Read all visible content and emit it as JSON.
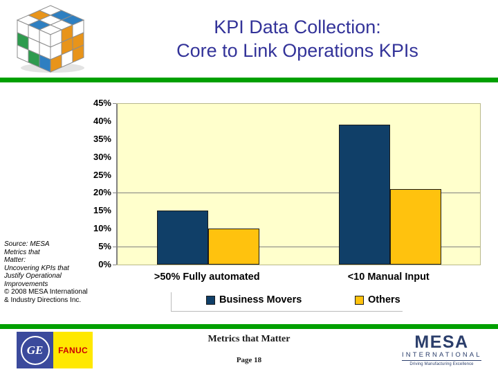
{
  "slide": {
    "title_lines": [
      "KPI Data Collection:",
      "Core to Link Operations KPIs"
    ],
    "title_color": "#333399",
    "accent_rule_color": "#00a000",
    "logo_icon": "rubiks-cube-logo"
  },
  "source_note": {
    "line1": "Source: MESA",
    "line2": "Metrics that",
    "line3": "Matter:",
    "line4": "Uncovering KPIs that",
    "line5": "Justify Operational",
    "line6": "Improvements",
    "line7": "© 2008 MESA International",
    "line8": "& Industry Directions Inc."
  },
  "footer": {
    "ge_text": "GE",
    "fanuc_text": "FANUC",
    "center_title": "Metrics that Matter",
    "page_label": "Page 18",
    "mesa_main": "MESA",
    "mesa_sub": "INTERNATIONAL",
    "mesa_tagline": "Driving Manufacturing Excellence"
  },
  "chart_data": {
    "type": "bar",
    "title": "",
    "xlabel": "",
    "ylabel": "",
    "categories": [
      ">50% Fully automated",
      "<10 Manual Input"
    ],
    "series": [
      {
        "name": "Business Movers",
        "color": "#103f68",
        "values": [
          15,
          39
        ]
      },
      {
        "name": "Others",
        "color": "#ffc20e",
        "values": [
          10,
          21
        ]
      }
    ],
    "ylim": [
      0,
      45
    ],
    "ytick_labels": [
      "45%",
      "40%",
      "35%",
      "30%",
      "25%",
      "20%",
      "15%",
      "10%",
      "5%",
      "0%"
    ],
    "ytick_values": [
      45,
      40,
      35,
      30,
      25,
      20,
      15,
      10,
      5,
      0
    ],
    "gridlines_at": [
      20,
      5
    ],
    "grid": true,
    "legend_position": "bottom",
    "plot_background": "#ffffcc"
  }
}
